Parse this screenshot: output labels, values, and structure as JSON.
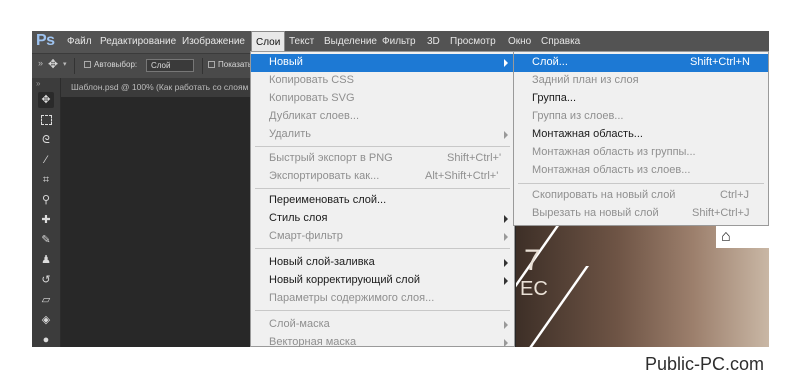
{
  "app": {
    "logo": "Ps"
  },
  "menubar": {
    "items": [
      "Файл",
      "Редактирование",
      "Изображение",
      "Слои",
      "Текст",
      "Выделение",
      "Фильтр",
      "3D",
      "Просмотр",
      "Окно",
      "Справка"
    ],
    "active": "Слои"
  },
  "options_bar": {
    "auto_select_label": "Автовыбор:",
    "auto_select_value": "Слой",
    "show_label": "Показать"
  },
  "document_tab": {
    "title": "Шаблон.psd @ 100% (Как работать со слоям"
  },
  "layers_menu": {
    "items": [
      {
        "label": "Новый",
        "shortcut": "",
        "submenu": true,
        "disabled": false,
        "highlighted": true
      },
      {
        "label": "Копировать CSS",
        "shortcut": "",
        "submenu": false,
        "disabled": true
      },
      {
        "label": "Копировать SVG",
        "shortcut": "",
        "submenu": false,
        "disabled": true
      },
      {
        "label": "Дубликат слоев...",
        "shortcut": "",
        "submenu": false,
        "disabled": true
      },
      {
        "label": "Удалить",
        "shortcut": "",
        "submenu": true,
        "disabled": true
      },
      {
        "label": "Быстрый экспорт в PNG",
        "shortcut": "Shift+Ctrl+'",
        "submenu": false,
        "disabled": true
      },
      {
        "label": "Экспортировать как...",
        "shortcut": "Alt+Shift+Ctrl+'",
        "submenu": false,
        "disabled": true
      },
      {
        "label": "Переименовать слой...",
        "shortcut": "",
        "submenu": false,
        "disabled": false
      },
      {
        "label": "Стиль слоя",
        "shortcut": "",
        "submenu": true,
        "disabled": false
      },
      {
        "label": "Смарт-фильтр",
        "shortcut": "",
        "submenu": true,
        "disabled": true
      },
      {
        "label": "Новый слой-заливка",
        "shortcut": "",
        "submenu": true,
        "disabled": false
      },
      {
        "label": "Новый корректирующий слой",
        "shortcut": "",
        "submenu": true,
        "disabled": false
      },
      {
        "label": "Параметры содержимого слоя...",
        "shortcut": "",
        "submenu": false,
        "disabled": true
      },
      {
        "label": "Слой-маска",
        "shortcut": "",
        "submenu": true,
        "disabled": true
      },
      {
        "label": "Векторная маска",
        "shortcut": "",
        "submenu": true,
        "disabled": true
      }
    ]
  },
  "new_submenu": {
    "items": [
      {
        "label": "Слой...",
        "shortcut": "Shift+Ctrl+N",
        "disabled": false,
        "highlighted": true
      },
      {
        "label": "Задний план из слоя",
        "shortcut": "",
        "disabled": true
      },
      {
        "label": "Группа...",
        "shortcut": "",
        "disabled": false
      },
      {
        "label": "Группа из слоев...",
        "shortcut": "",
        "disabled": true
      },
      {
        "label": "Монтажная область...",
        "shortcut": "",
        "disabled": false
      },
      {
        "label": "Монтажная область из группы...",
        "shortcut": "",
        "disabled": true
      },
      {
        "label": "Монтажная область из слоев...",
        "shortcut": "",
        "disabled": true
      },
      {
        "label": "Скопировать на новый слой",
        "shortcut": "Ctrl+J",
        "disabled": true
      },
      {
        "label": "Вырезать на новый слой",
        "shortcut": "Shift+Ctrl+J",
        "disabled": true
      }
    ]
  },
  "tools": [
    "move-tool-icon",
    "marquee-tool-icon",
    "lasso-tool-icon",
    "magic-wand-icon",
    "crop-tool-icon",
    "eyedropper-icon",
    "healing-brush-icon",
    "brush-tool-icon",
    "clone-stamp-icon",
    "history-brush-icon",
    "eraser-icon",
    "paint-bucket-icon",
    "blur-tool-icon"
  ],
  "canvas_fragments": {
    "text1": "7",
    "text2": "ЕС"
  },
  "watermark": "Public-PC.com",
  "colors": {
    "highlight": "#1d79d4",
    "menu_bg": "#f0f0f0",
    "ui_dark": "#535353"
  }
}
